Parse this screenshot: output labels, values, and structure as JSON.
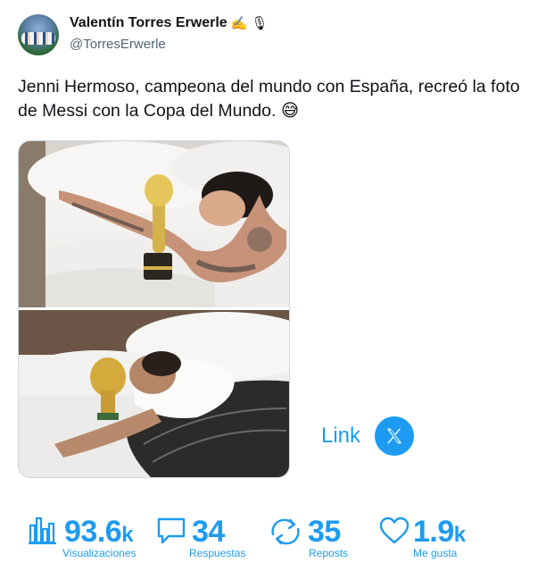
{
  "author": {
    "display_name": "Valentín Torres Erwerle",
    "badges": [
      "✍️",
      "🎙"
    ],
    "handle": "@TorresErwerle"
  },
  "tweet": {
    "text": "Jenni Hermoso, campeona del mundo con España, recreó la foto de Messi con la Copa del Mundo.",
    "emoji": "😅"
  },
  "media": {
    "image_count": 2
  },
  "link": {
    "label": "Link",
    "icon": "x-logo-icon"
  },
  "stats": {
    "views": {
      "value": "93.6",
      "suffix": "k",
      "label": "Visualizaciones",
      "icon": "bar-chart-icon"
    },
    "replies": {
      "value": "34",
      "label": "Respuestas",
      "icon": "speech-bubble-icon"
    },
    "reposts": {
      "value": "35",
      "label": "Reposts",
      "icon": "repost-arrows-icon"
    },
    "likes": {
      "value": "1.9",
      "suffix": "k",
      "label": "Me gusta",
      "icon": "heart-icon"
    }
  },
  "colors": {
    "accent": "#1d9bf0",
    "text": "#0f1419",
    "secondary": "#536471"
  }
}
